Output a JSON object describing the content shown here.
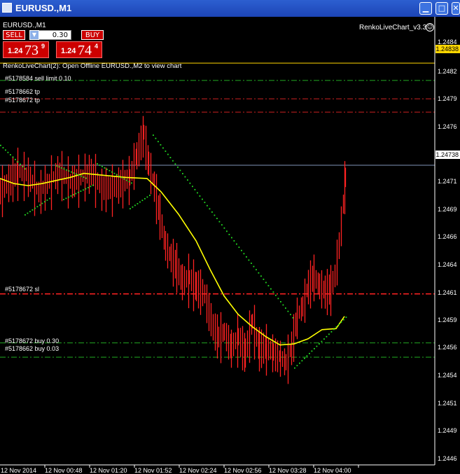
{
  "window": {
    "title": "EURUSD.,M1"
  },
  "chart_header": {
    "symbol": "EURUSD.,M1",
    "indicator": "RenkoLiveChart_v3.3",
    "message": "RenkoLiveChart(2): Open Offline EURUSD.,M2 to view chart"
  },
  "trade_panel": {
    "sell_label": "SELL",
    "buy_label": "BUY",
    "lot": "0.30",
    "bid_prefix": "1.24",
    "bid_big": "73",
    "bid_sup": "9",
    "ask_prefix": "1.24",
    "ask_big": "74",
    "ask_sup": "4"
  },
  "order_lines": [
    {
      "label": "#5178584 sell limit 0.10",
      "price": 1.24821,
      "color": "#22aa22"
    },
    {
      "label": "#5178662 tp",
      "price": 1.24803,
      "color": "#cc2222"
    },
    {
      "label": "#5178672 tp",
      "price": 1.2479,
      "color": "#cc2222"
    },
    {
      "label": "#5178672 sl",
      "price": 1.24612,
      "color": "#ff2222"
    },
    {
      "label": "#5178672 buy 0.30",
      "price": 1.24564,
      "color": "#22aa22"
    },
    {
      "label": "#5178662 buy 0.03",
      "price": 1.2455,
      "color": "#22aa22"
    }
  ],
  "price_axis": {
    "ticks": [
      "1.2484",
      "1.2482",
      "1.2479",
      "1.2476",
      "1.2473",
      "1.2471",
      "1.2469",
      "1.2466",
      "1.2464",
      "1.2461",
      "1.2459",
      "1.2456",
      "1.2454",
      "1.2451",
      "1.2449",
      "1.2446"
    ],
    "ask_tag": "1.24838",
    "bid_tag": "1.24738",
    "ask_price": 1.24838,
    "bid_price": 1.24738,
    "top_price": 1.2486,
    "bottom_price": 1.2445
  },
  "time_axis": {
    "labels": [
      "12 Nov 2014",
      "12 Nov 00:48",
      "12 Nov 01:20",
      "12 Nov 01:52",
      "12 Nov 02:24",
      "12 Nov 02:56",
      "12 Nov 03:28",
      "12 Nov 04:00"
    ]
  },
  "colors": {
    "bar": "#ff2222",
    "ma_yellow": "#ffff00",
    "dots_green": "#22dd22",
    "ask_line": "#ffd700",
    "bid_line": "#7f93b8",
    "grid": "#444444"
  }
}
